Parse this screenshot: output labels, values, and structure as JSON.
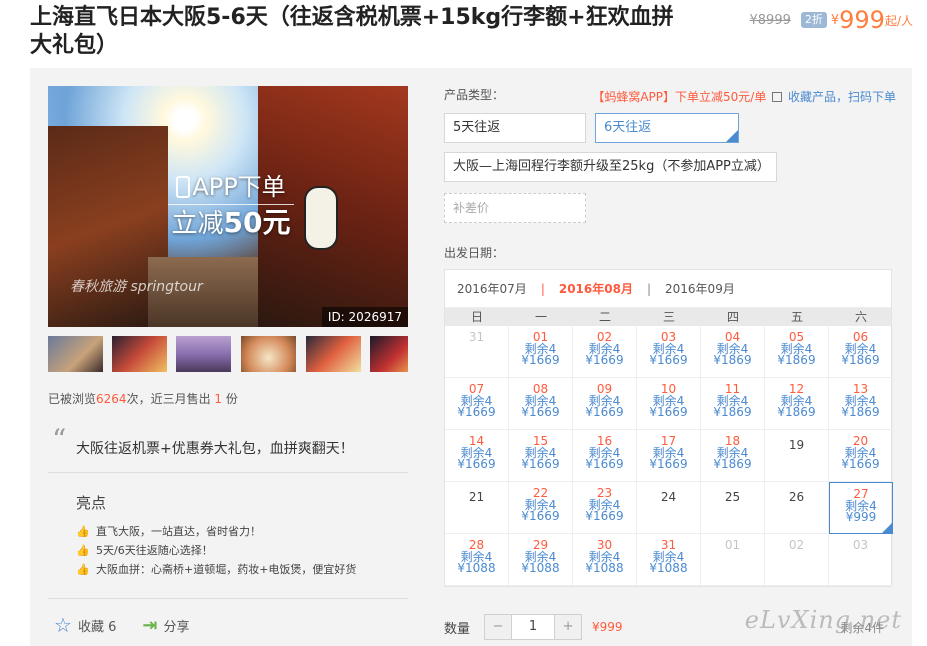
{
  "product": {
    "title": "上海直飞日本大阪5-6天（往返含税机票+15kg行李额+狂欢血拼大礼包）",
    "original_price": "¥8999",
    "discount_badge": "2折",
    "currency": "¥",
    "price": "999",
    "price_suffix": "起/人"
  },
  "gallery": {
    "promo_line1": "APP下单",
    "promo_line2_prefix": "立减",
    "promo_line2_amount": "50元",
    "watermark": "春秋旅游 springtour",
    "photo_id": "ID: 2026917",
    "thumbnail_count": 6
  },
  "stats": {
    "views_prefix": "已被浏览",
    "views": "6264",
    "views_mid": "次，近三月售出",
    "sold": "1",
    "sold_suffix": "份"
  },
  "slogan": "大阪往返机票+优惠券大礼包，血拼爽翻天！",
  "highlights": {
    "title": "亮点",
    "items": [
      "直飞大阪，一站直达，省时省力！",
      "5天/6天往返随心选择！",
      "大阪血拼：心斋桥+道顿堀，药妆+电饭煲，便宜好货"
    ]
  },
  "actions": {
    "favorite_label": "收藏 6",
    "share_label": "分享"
  },
  "options": {
    "type_label": "产品类型：",
    "promo_red": "【蚂蜂窝APP】下单立减50元/单",
    "promo_blue": "收藏产品，扫码下单",
    "choices": [
      "5天往返",
      "6天往返"
    ],
    "selected": "6天往返",
    "upgrade": "大阪—上海回程行李额升级至25kg（不参加APP立减）",
    "supplement": "补差价"
  },
  "calendar": {
    "label": "出发日期：",
    "months": [
      "2016年07月",
      "2016年08月",
      "2016年09月"
    ],
    "active_month": "2016年08月",
    "weekdays": [
      "日",
      "一",
      "二",
      "三",
      "四",
      "五",
      "六"
    ],
    "remain_prefix": "剩余",
    "cells": [
      {
        "d": "31",
        "state": "dim"
      },
      {
        "d": "01",
        "stock": "4",
        "price": "¥1669"
      },
      {
        "d": "02",
        "stock": "4",
        "price": "¥1669"
      },
      {
        "d": "03",
        "stock": "4",
        "price": "¥1669"
      },
      {
        "d": "04",
        "stock": "4",
        "price": "¥1869"
      },
      {
        "d": "05",
        "stock": "4",
        "price": "¥1869"
      },
      {
        "d": "06",
        "stock": "4",
        "price": "¥1869"
      },
      {
        "d": "07",
        "stock": "4",
        "price": "¥1669"
      },
      {
        "d": "08",
        "stock": "4",
        "price": "¥1669"
      },
      {
        "d": "09",
        "stock": "4",
        "price": "¥1669"
      },
      {
        "d": "10",
        "stock": "4",
        "price": "¥1669"
      },
      {
        "d": "11",
        "stock": "4",
        "price": "¥1869"
      },
      {
        "d": "12",
        "stock": "4",
        "price": "¥1869"
      },
      {
        "d": "13",
        "stock": "4",
        "price": "¥1869"
      },
      {
        "d": "14",
        "stock": "4",
        "price": "¥1669"
      },
      {
        "d": "15",
        "stock": "4",
        "price": "¥1669"
      },
      {
        "d": "16",
        "stock": "4",
        "price": "¥1669"
      },
      {
        "d": "17",
        "stock": "4",
        "price": "¥1669"
      },
      {
        "d": "18",
        "stock": "4",
        "price": "¥1869"
      },
      {
        "d": "19",
        "state": "plain"
      },
      {
        "d": "20",
        "stock": "4",
        "price": "¥1669"
      },
      {
        "d": "21",
        "state": "plain"
      },
      {
        "d": "22",
        "stock": "4",
        "price": "¥1669"
      },
      {
        "d": "23",
        "stock": "4",
        "price": "¥1669"
      },
      {
        "d": "24",
        "state": "plain"
      },
      {
        "d": "25",
        "state": "plain"
      },
      {
        "d": "26",
        "state": "plain"
      },
      {
        "d": "27",
        "stock": "4",
        "price": "¥999",
        "selected": true
      },
      {
        "d": "28",
        "stock": "4",
        "price": "¥1088"
      },
      {
        "d": "29",
        "stock": "4",
        "price": "¥1088"
      },
      {
        "d": "30",
        "stock": "4",
        "price": "¥1088"
      },
      {
        "d": "31",
        "stock": "4",
        "price": "¥1088"
      },
      {
        "d": "01",
        "state": "dim"
      },
      {
        "d": "02",
        "state": "dim"
      },
      {
        "d": "03",
        "state": "dim"
      }
    ]
  },
  "quantity": {
    "label": "数量",
    "minus": "−",
    "plus": "+",
    "value": "1",
    "price": "¥999",
    "remaining": "剩余4件"
  },
  "site_watermark": "eLvXing.net",
  "colors": {
    "accent_orange": "#ff5a3c",
    "link_blue": "#4a8ad0",
    "panel_bg": "#f3f3f3"
  }
}
